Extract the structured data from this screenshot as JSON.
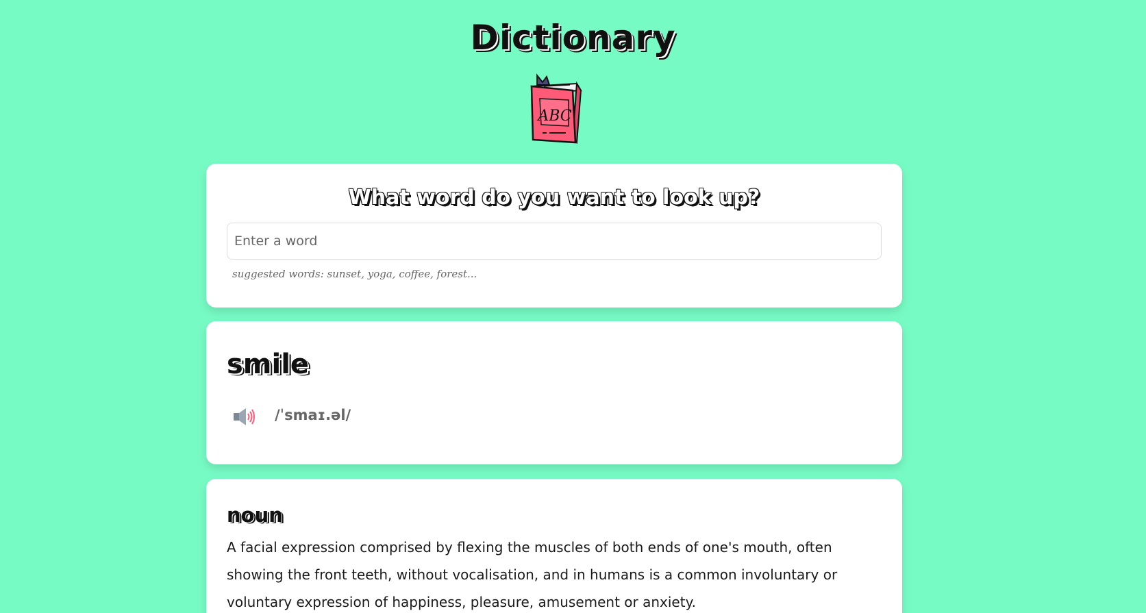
{
  "app": {
    "title": "Dictionary",
    "logo_text": "ABC"
  },
  "search": {
    "heading": "What word do you want to look up?",
    "placeholder": "Enter a word",
    "value": "",
    "suggestions": "suggested words: sunset, yoga, coffee, forest..."
  },
  "result": {
    "word": "smile",
    "phonetic": "/ˈsmaɪ.əl/",
    "audio_icon": "speaker-icon"
  },
  "meanings": [
    {
      "part_of_speech": "noun",
      "definition": "A facial expression comprised by flexing the muscles of both ends of one's mouth, often showing the front teeth, without vocalisation, and in humans is a common involuntary or voluntary expression of happiness, pleasure, amusement or anxiety."
    }
  ],
  "colors": {
    "background": "#77fbc5",
    "card": "#ffffff",
    "book": "#ff5a78",
    "ink": "#111111"
  }
}
